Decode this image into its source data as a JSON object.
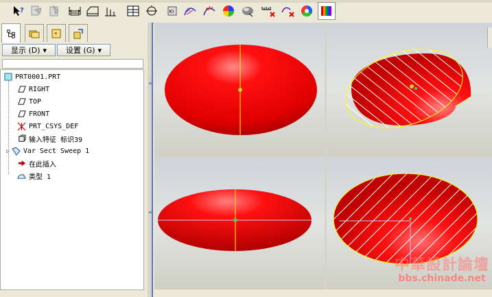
{
  "toolbar": {
    "buttons": [
      {
        "icon": "context-help-icon"
      },
      {
        "icon": "copy-dimension-icon"
      },
      {
        "icon": "paste-dimension-icon"
      },
      {
        "icon": "linear-dimension-icon"
      },
      {
        "icon": "chamfer-dimension-icon"
      },
      {
        "icon": "ordinate-dimension-icon"
      },
      {
        "icon": "table-icon"
      },
      {
        "icon": "angle-dimension-icon"
      },
      {
        "icon": "ki-tool-icon"
      },
      {
        "icon": "curve-analysis-icon"
      },
      {
        "icon": "curvature-icon"
      },
      {
        "icon": "color-sphere-icon"
      },
      {
        "icon": "shade-sphere-icon"
      },
      {
        "icon": "dimension-delete-icon"
      },
      {
        "icon": "curve-delete-icon"
      },
      {
        "icon": "color-wheel-icon"
      },
      {
        "icon": "color-bars-icon"
      }
    ]
  },
  "panel": {
    "tabs": [
      {
        "icon": "model-tree-icon"
      },
      {
        "icon": "folder-icon"
      },
      {
        "icon": "favorites-icon"
      },
      {
        "icon": "connections-icon"
      }
    ],
    "display_label": "显示 (D)",
    "settings_label": "设置 (G)",
    "tree": [
      {
        "label": "PRT0001.PRT",
        "icon": "part-icon"
      },
      {
        "label": "RIGHT",
        "icon": "datum-plane-icon"
      },
      {
        "label": "TOP",
        "icon": "datum-plane-icon"
      },
      {
        "label": "FRONT",
        "icon": "datum-plane-icon"
      },
      {
        "label": "PRT_CSYS_DEF",
        "icon": "csys-icon"
      },
      {
        "label": "输入特征 标识39",
        "icon": "import-feature-icon"
      },
      {
        "label": "Var Sect Sweep 1",
        "icon": "sweep-icon"
      },
      {
        "label": "在此插入",
        "icon": "insert-here-icon"
      },
      {
        "label": "类型 1",
        "icon": "type-icon"
      }
    ]
  },
  "watermark": {
    "text": "中華設計論壇",
    "url": "bbs.chinade.net"
  },
  "colors": {
    "model_red": "#ff0000",
    "edge_yellow": "#ffff00",
    "hatch_white": "#ffffff"
  }
}
